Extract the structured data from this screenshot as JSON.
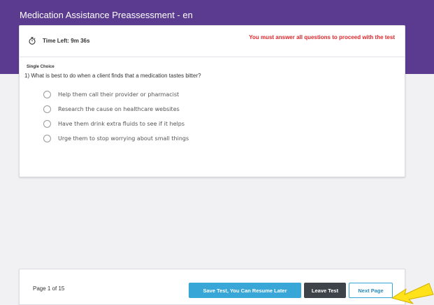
{
  "app": {
    "title": "Medication Assistance Preassessment - en"
  },
  "timer": {
    "icon": "stopwatch-icon",
    "label": "Time Left: 9m 36s"
  },
  "warning": {
    "text": "You must answer all questions to proceed with the test",
    "color": "#e0262c"
  },
  "question": {
    "type": "Single Choice",
    "text": "1) What is best to do when a client finds that a medication tastes bitter?",
    "options": [
      {
        "label": "Help them call their provider or pharmacist",
        "selected": false
      },
      {
        "label": "Research the cause on healthcare websites",
        "selected": false
      },
      {
        "label": "Have them drink extra fluids to see if it helps",
        "selected": false
      },
      {
        "label": "Urge them to stop worrying about small things",
        "selected": false
      }
    ]
  },
  "footer": {
    "page_info": "Page 1 of 15",
    "save_label": "Save Test, You Can Resume Later",
    "leave_label": "Leave Test",
    "next_label": "Next Page"
  },
  "colors": {
    "banner": "#5b3b8f",
    "primary": "#38a6d6",
    "dark_button": "#3e4349",
    "pointer": "#ffe21a"
  }
}
